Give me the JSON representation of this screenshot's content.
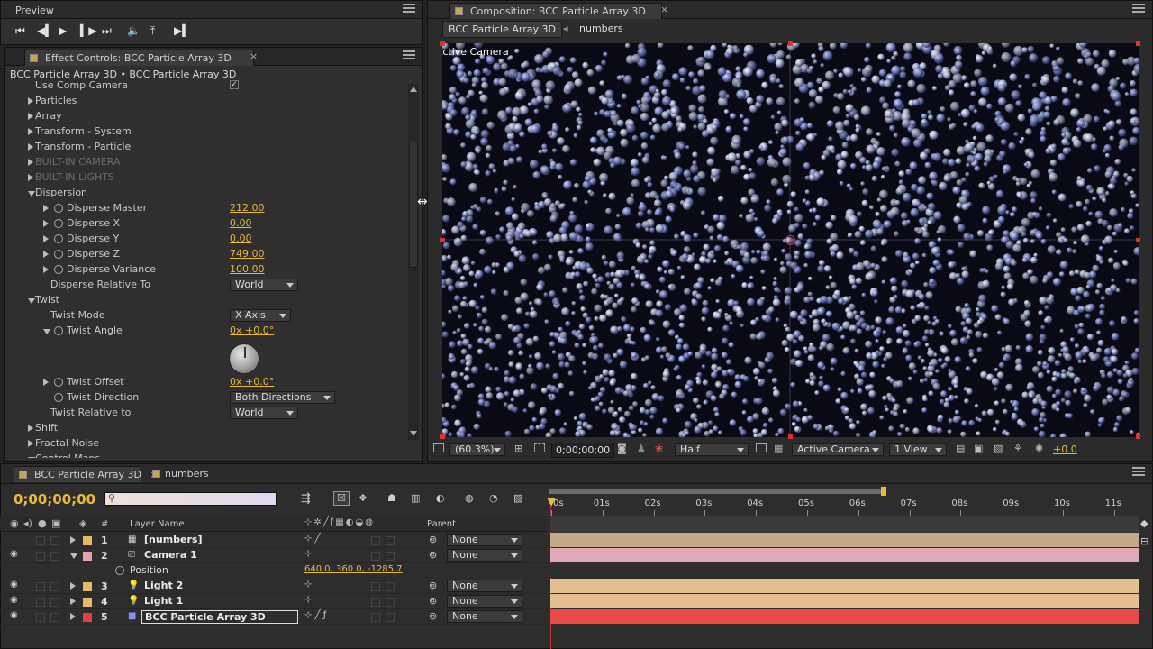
{
  "preview": {
    "tab": "Preview"
  },
  "effect_controls": {
    "tab": "Effect Controls: BCC Particle Array 3D",
    "subtitle": "BCC Particle Array 3D • BCC Particle Array 3D",
    "rows": [
      {
        "label": "Use Comp Camera",
        "indent": 0,
        "arrow": "none",
        "stopwatch": false,
        "dim": false,
        "checkbox": true
      },
      {
        "label": "Particles",
        "indent": 0,
        "arrow": "right",
        "stopwatch": false,
        "dim": false
      },
      {
        "label": "Array",
        "indent": 0,
        "arrow": "right",
        "stopwatch": false,
        "dim": false
      },
      {
        "label": "Transform - System",
        "indent": 0,
        "arrow": "right",
        "stopwatch": false,
        "dim": false
      },
      {
        "label": "Transform - Particle",
        "indent": 0,
        "arrow": "right",
        "stopwatch": false,
        "dim": false
      },
      {
        "label": "BUILT-IN CAMERA",
        "indent": 0,
        "arrow": "right",
        "stopwatch": false,
        "dim": true
      },
      {
        "label": "BUILT-IN LIGHTS",
        "indent": 0,
        "arrow": "right",
        "stopwatch": false,
        "dim": true
      },
      {
        "label": "Dispersion",
        "indent": 0,
        "arrow": "down",
        "stopwatch": false,
        "dim": false
      },
      {
        "label": "Disperse Master",
        "indent": 1,
        "arrow": "right",
        "stopwatch": true,
        "value": "212.00"
      },
      {
        "label": "Disperse X",
        "indent": 1,
        "arrow": "right",
        "stopwatch": true,
        "value": "0.00"
      },
      {
        "label": "Disperse Y",
        "indent": 1,
        "arrow": "right",
        "stopwatch": true,
        "value": "0.00"
      },
      {
        "label": "Disperse Z",
        "indent": 1,
        "arrow": "right",
        "stopwatch": true,
        "value": "749.00"
      },
      {
        "label": "Disperse Variance",
        "indent": 1,
        "arrow": "right",
        "stopwatch": true,
        "value": "100.00"
      },
      {
        "label": "Disperse Relative To",
        "indent": 1,
        "arrow": "none",
        "stopwatch": false,
        "dropdown": "World"
      },
      {
        "label": "Twist",
        "indent": 0,
        "arrow": "down",
        "stopwatch": false,
        "dim": false
      },
      {
        "label": "Twist Mode",
        "indent": 1,
        "arrow": "none",
        "stopwatch": false,
        "dropdown": "X Axis"
      },
      {
        "label": "Twist Angle",
        "indent": 1,
        "arrow": "down",
        "stopwatch": true,
        "value": "0x +0.0°",
        "knob": true
      },
      {
        "label": "Twist Offset",
        "indent": 1,
        "arrow": "right",
        "stopwatch": true,
        "value": "0x +0.0°"
      },
      {
        "label": "Twist Direction",
        "indent": 1,
        "arrow": "none",
        "stopwatch": true,
        "dropdown": "Both Directions"
      },
      {
        "label": "Twist Relative to",
        "indent": 1,
        "arrow": "none",
        "stopwatch": false,
        "dropdown": "World"
      },
      {
        "label": "Shift",
        "indent": 0,
        "arrow": "right",
        "stopwatch": false,
        "dim": false
      },
      {
        "label": "Fractal Noise",
        "indent": 0,
        "arrow": "right",
        "stopwatch": false,
        "dim": false
      },
      {
        "label": "Control Maps",
        "indent": 0,
        "arrow": "down",
        "stopwatch": false,
        "dim": false
      }
    ]
  },
  "composition": {
    "tab": "Composition: BCC Particle Array 3D",
    "breadcrumb_active": "BCC Particle Array 3D",
    "breadcrumb_other": "numbers",
    "viewer_label": "Active Camera",
    "footer": {
      "zoom": "(60.3%)",
      "timecode": "0;00;00;00",
      "resolution": "Half",
      "camera": "Active Camera",
      "views": "1 View",
      "exposure": "+0.0"
    }
  },
  "timeline": {
    "tabs": [
      "BCC Particle Array 3D",
      "numbers"
    ],
    "timecode": "0;00;00;00",
    "header": {
      "hash": "#",
      "layer_name": "Layer Name",
      "parent": "Parent"
    },
    "ruler": [
      "0s",
      "01s",
      "02s",
      "03s",
      "04s",
      "05s",
      "06s",
      "07s",
      "08s",
      "09s",
      "10s",
      "11s"
    ],
    "layers": [
      {
        "num": "1",
        "name": "[numbers]",
        "color": "#e8b864",
        "bar_color": "#c4a88a",
        "parent": "None",
        "eye": false
      },
      {
        "num": "2",
        "name": "Camera 1",
        "color": "#e8a0b0",
        "bar_color": "#e0a8b8",
        "parent": "None",
        "eye": true,
        "expanded": true
      },
      {
        "num": "3",
        "name": "Light 2",
        "color": "#e8b864",
        "bar_color": "#e3bf90",
        "parent": "None",
        "eye": true
      },
      {
        "num": "4",
        "name": "Light 1",
        "color": "#e8b864",
        "bar_color": "#e3bf90",
        "parent": "None",
        "eye": true
      },
      {
        "num": "5",
        "name": "BCC Particle Array 3D",
        "color": "#e04040",
        "bar_color": "#e84a4a",
        "parent": "None",
        "eye": true,
        "selected": true
      }
    ],
    "position_row": {
      "label": "Position",
      "value": "640.0, 360.0, -1285.7"
    }
  }
}
